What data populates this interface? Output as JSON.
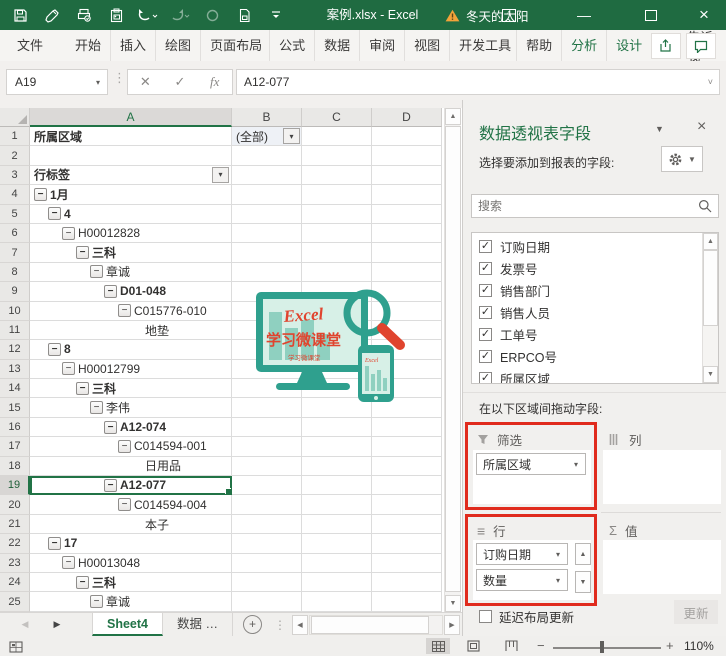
{
  "titlebar": {
    "title": "案例.xlsx - Excel",
    "account": "冬天的太阳",
    "qat_icons": [
      "save-icon",
      "format-painter-icon",
      "quick-print-icon",
      "paste-icon",
      "undo-icon",
      "redo-icon",
      "touch-mode-icon",
      "print-preview-icon",
      "customize-qat-icon"
    ],
    "window_icons": [
      "warning-icon",
      "ribbon-display-options-icon",
      "minimize-icon",
      "maximize-icon",
      "close-icon"
    ]
  },
  "ribbon": {
    "tabs": [
      {
        "id": "file",
        "label": "文件"
      },
      {
        "id": "home",
        "label": "开始"
      },
      {
        "id": "insert",
        "label": "插入"
      },
      {
        "id": "draw",
        "label": "绘图"
      },
      {
        "id": "pagelayout",
        "label": "页面布局"
      },
      {
        "id": "formulas",
        "label": "公式"
      },
      {
        "id": "data",
        "label": "数据"
      },
      {
        "id": "review",
        "label": "审阅"
      },
      {
        "id": "view",
        "label": "视图"
      },
      {
        "id": "developer",
        "label": "开发工具"
      },
      {
        "id": "help",
        "label": "帮助"
      },
      {
        "id": "analyze",
        "label": "分析",
        "accent": true
      },
      {
        "id": "design",
        "label": "设计",
        "accent": true
      }
    ],
    "tell_me": "告诉我"
  },
  "formula_bar": {
    "name_box": "A19",
    "value": "A12-077"
  },
  "grid": {
    "col_headers": [
      "A",
      "B",
      "C",
      "D"
    ],
    "filter_row": {
      "label": "所属区域",
      "value": "(全部)"
    },
    "rows": [
      {
        "n": 1,
        "type": "filter"
      },
      {
        "n": 2,
        "type": "empty"
      },
      {
        "n": 3,
        "type": "header",
        "text": "行标签"
      },
      {
        "n": 4,
        "text": "1月",
        "lvl": 0,
        "btn": true,
        "bold": true
      },
      {
        "n": 5,
        "text": "4",
        "lvl": 1,
        "btn": true,
        "bold": true
      },
      {
        "n": 6,
        "text": "H00012828",
        "lvl": 2,
        "btn": true
      },
      {
        "n": 7,
        "text": "三科",
        "lvl": 3,
        "btn": true,
        "bold": true
      },
      {
        "n": 8,
        "text": "章诚",
        "lvl": 4,
        "btn": true
      },
      {
        "n": 9,
        "text": "D01-048",
        "lvl": 5,
        "btn": true,
        "bold": true
      },
      {
        "n": 10,
        "text": "C015776-010",
        "lvl": 6,
        "btn": true
      },
      {
        "n": 11,
        "text": "地垫",
        "lvl": 7
      },
      {
        "n": 12,
        "text": "8",
        "lvl": 1,
        "btn": true,
        "bold": true
      },
      {
        "n": 13,
        "text": "H00012799",
        "lvl": 2,
        "btn": true
      },
      {
        "n": 14,
        "text": "三科",
        "lvl": 3,
        "btn": true,
        "bold": true
      },
      {
        "n": 15,
        "text": "李伟",
        "lvl": 4,
        "btn": true
      },
      {
        "n": 16,
        "text": "A12-074",
        "lvl": 5,
        "btn": true,
        "bold": true
      },
      {
        "n": 17,
        "text": "C014594-001",
        "lvl": 6,
        "btn": true
      },
      {
        "n": 18,
        "text": "日用品",
        "lvl": 7
      },
      {
        "n": 19,
        "text": "A12-077",
        "lvl": 5,
        "btn": true,
        "bold": true,
        "selected": true
      },
      {
        "n": 20,
        "text": "C014594-004",
        "lvl": 6,
        "btn": true
      },
      {
        "n": 21,
        "text": "本子",
        "lvl": 7
      },
      {
        "n": 22,
        "text": "17",
        "lvl": 1,
        "btn": true,
        "bold": true
      },
      {
        "n": 23,
        "text": "H00013048",
        "lvl": 2,
        "btn": true
      },
      {
        "n": 24,
        "text": "三科",
        "lvl": 3,
        "btn": true,
        "bold": true
      },
      {
        "n": 25,
        "text": "章诚",
        "lvl": 4,
        "btn": true
      }
    ]
  },
  "watermark": {
    "line1": "Excel",
    "line2": "学习微课堂",
    "line3": "学习微课堂"
  },
  "sheet_bar": {
    "tabs": [
      {
        "label": "Sheet4",
        "active": true
      },
      {
        "label": "数据 …",
        "active": false
      }
    ]
  },
  "status_bar": {
    "zoom_level": "110%",
    "view_icons": [
      "normal-view-icon",
      "page-layout-view-icon",
      "page-break-preview-icon"
    ]
  },
  "pane": {
    "title": "数据透视表字段",
    "subtitle": "选择要添加到报表的字段:",
    "search_placeholder": "搜索",
    "fields": [
      {
        "label": "订购日期",
        "checked": true
      },
      {
        "label": "发票号",
        "checked": true
      },
      {
        "label": "销售部门",
        "checked": true
      },
      {
        "label": "销售人员",
        "checked": true
      },
      {
        "label": "工单号",
        "checked": true
      },
      {
        "label": "ERPCO号",
        "checked": true
      },
      {
        "label": "所属区域",
        "checked": true
      }
    ],
    "drag_hint": "在以下区域间拖动字段:",
    "areas": {
      "filters": {
        "label": "筛选",
        "items": [
          "所属区域"
        ],
        "highlighted": true
      },
      "columns": {
        "label": "列",
        "items": []
      },
      "rows": {
        "label": "行",
        "items": [
          "订购日期",
          "数量"
        ],
        "highlighted": true
      },
      "values": {
        "label": "值",
        "items": []
      }
    },
    "defer_label": "延迟布局更新",
    "update_label": "更新",
    "highlight_color": "#e02b1d",
    "accent_color": "#217346"
  }
}
